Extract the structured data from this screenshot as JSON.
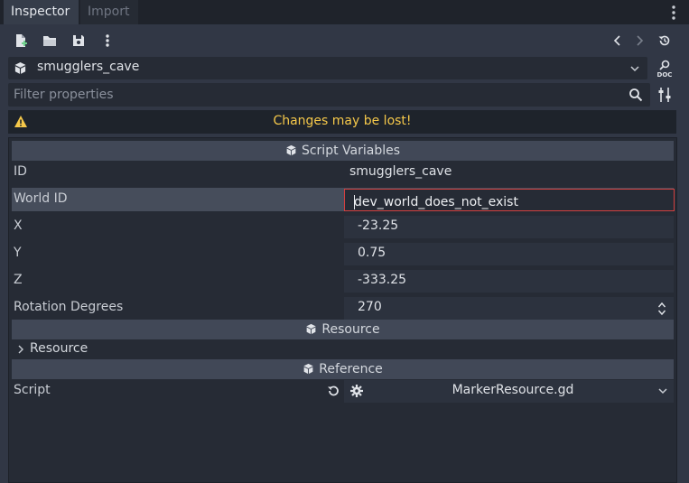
{
  "tabs": {
    "inspector": "Inspector",
    "import": "Import"
  },
  "object": {
    "name": "smugglers_cave",
    "doc_label": "DOC"
  },
  "filter": {
    "placeholder": "Filter properties"
  },
  "warning": {
    "text": "Changes may be lost!"
  },
  "sections": {
    "script_variables": "Script Variables",
    "resource": "Resource",
    "reference": "Reference"
  },
  "properties": {
    "id": {
      "label": "ID",
      "value": "smugglers_cave"
    },
    "world_id": {
      "label": "World ID",
      "value": "dev_world_does_not_exist"
    },
    "x": {
      "label": "X",
      "value": "-23.25"
    },
    "y": {
      "label": "Y",
      "value": "0.75"
    },
    "z": {
      "label": "Z",
      "value": "-333.25"
    },
    "rotation": {
      "label": "Rotation Degrees",
      "value": "270"
    }
  },
  "resource_group": {
    "label": "Resource"
  },
  "script": {
    "label": "Script",
    "value": "MarkerResource.gd"
  },
  "colors": {
    "warning": "#f5c84a",
    "error_border": "#d24040",
    "panel_bg": "#262b35"
  }
}
